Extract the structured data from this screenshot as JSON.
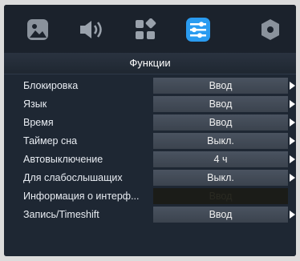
{
  "tabs": [
    {
      "name": "picture",
      "icon": "picture-icon"
    },
    {
      "name": "sound",
      "icon": "speaker-icon"
    },
    {
      "name": "channels",
      "icon": "channels-icon"
    },
    {
      "name": "functions",
      "icon": "sliders-icon",
      "active": true
    },
    {
      "name": "system",
      "icon": "hexagon-icon"
    }
  ],
  "header": {
    "title": "Функции"
  },
  "rows": [
    {
      "label": "Блокировка",
      "value": "Ввод"
    },
    {
      "label": "Язык",
      "value": "Ввод"
    },
    {
      "label": "Время",
      "value": "Ввод"
    },
    {
      "label": "Таймер сна",
      "value": "Выкл."
    },
    {
      "label": "Автовыключение",
      "value": "4 ч"
    },
    {
      "label": "Для слабослышащих",
      "value": "Выкл."
    },
    {
      "label": "Информация о интерф...",
      "value": "Ввод",
      "disabled": true
    },
    {
      "label": "Запись/Timeshift",
      "value": "Ввод"
    }
  ],
  "colors": {
    "accent": "#2a9bf0",
    "background": "#1e2733"
  }
}
